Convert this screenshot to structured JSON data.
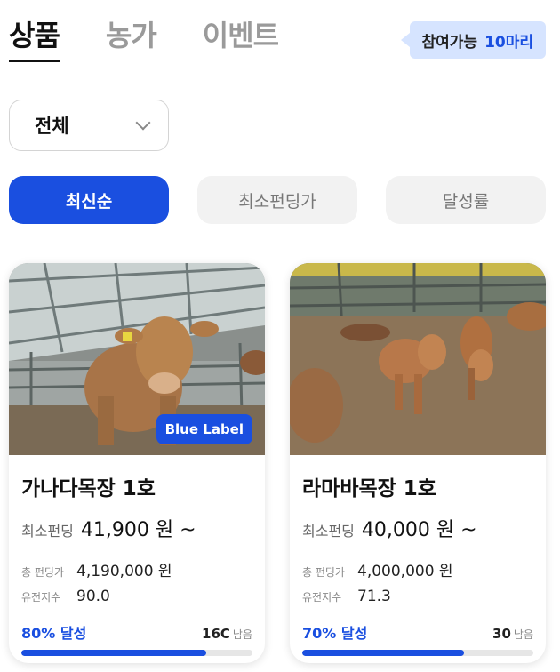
{
  "tabs": [
    {
      "label": "상품",
      "active": true
    },
    {
      "label": "농가",
      "active": false
    },
    {
      "label": "이벤트",
      "active": false
    }
  ],
  "badge": {
    "text": "참여가능",
    "count": "10마리"
  },
  "filter": {
    "selected": "전체"
  },
  "sort_chips": [
    {
      "label": "최신순",
      "active": true
    },
    {
      "label": "최소펀딩가",
      "active": false
    },
    {
      "label": "달성률",
      "active": false
    }
  ],
  "cards": [
    {
      "farm": "가나다목장 1호",
      "label": "Blue Label",
      "price_label": "최소펀딩",
      "price": "41,900 원 ~",
      "total_label": "총 펀딩가",
      "total": "4,190,000 원",
      "genetic_label": "유전지수",
      "genetic": "90.0",
      "achieve": "80% 달성",
      "progress": 0.8,
      "remaining": "16C",
      "remaining_unit": "남음"
    },
    {
      "farm": "라마바목장 1호",
      "label": "",
      "price_label": "최소펀딩",
      "price": "40,000 원 ~",
      "total_label": "총 펀딩가",
      "total": "4,000,000 원",
      "genetic_label": "유전지수",
      "genetic": "71.3",
      "achieve": "70% 달성",
      "progress": 0.7,
      "remaining": "30",
      "remaining_unit": "남음"
    }
  ],
  "colors": {
    "accent": "#1a4fe0",
    "badge_bg": "#d6e4ff"
  }
}
